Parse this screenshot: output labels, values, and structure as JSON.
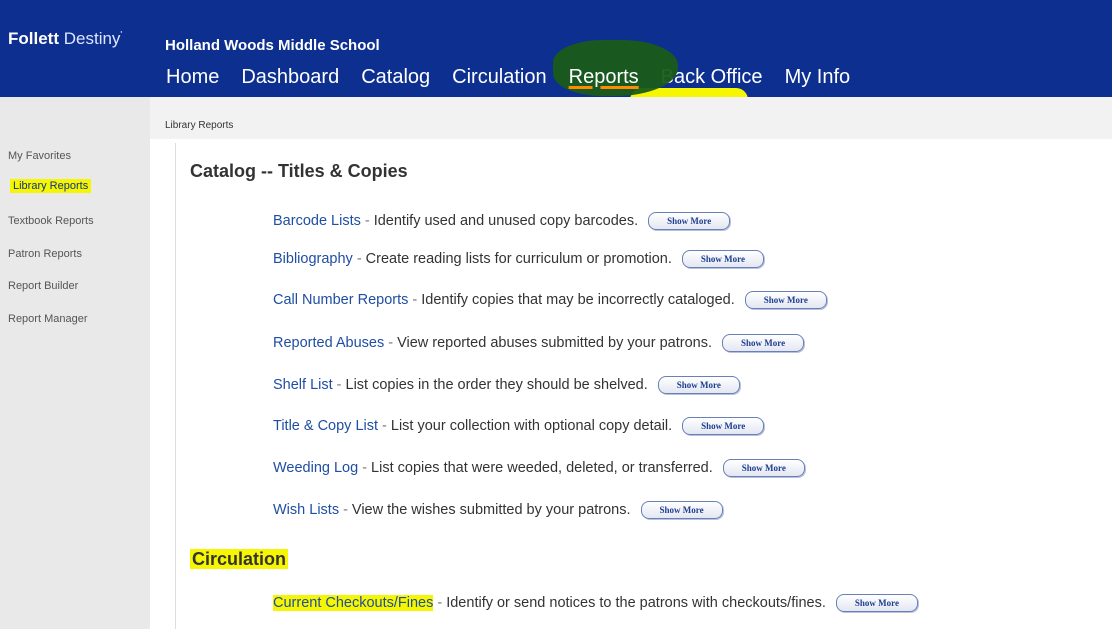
{
  "brand": {
    "name_bold": "Follett",
    "name_light": "Destiny",
    "mark": "'"
  },
  "school": "Holland Woods Middle School",
  "nav": [
    "Home",
    "Dashboard",
    "Catalog",
    "Circulation",
    "Reports",
    "Back Office",
    "My Info"
  ],
  "breadcrumb": "Library Reports",
  "sidebar": [
    "My Favorites",
    "Library Reports",
    "Textbook Reports",
    "Patron Reports",
    "Report Builder",
    "Report Manager"
  ],
  "sections": [
    {
      "title": "Catalog -- Titles & Copies",
      "reports": [
        {
          "name": "Barcode Lists",
          "desc": "Identify used and unused copy barcodes."
        },
        {
          "name": "Bibliography",
          "desc": "Create reading lists for curriculum or promotion."
        },
        {
          "name": "Call Number Reports",
          "desc": "Identify copies that may be incorrectly cataloged."
        },
        {
          "name": "Reported Abuses",
          "desc": "View reported abuses submitted by your patrons."
        },
        {
          "name": "Shelf List",
          "desc": "List copies in the order they should be shelved."
        },
        {
          "name": "Title & Copy List",
          "desc": "List your collection with optional copy detail."
        },
        {
          "name": "Weeding Log",
          "desc": "List copies that were weeded, deleted, or transferred."
        },
        {
          "name": "Wish Lists",
          "desc": "View the wishes submitted by your patrons."
        }
      ]
    },
    {
      "title": "Circulation",
      "reports": [
        {
          "name": "Current Checkouts/Fines",
          "desc": "Identify or send notices to the patrons with checkouts/fines."
        }
      ]
    }
  ],
  "show_more_label": "Show More",
  "sep": "-",
  "colors": {
    "header": "#0d2f8f",
    "highlight": "#f6f600",
    "link": "#1f4ea3"
  }
}
